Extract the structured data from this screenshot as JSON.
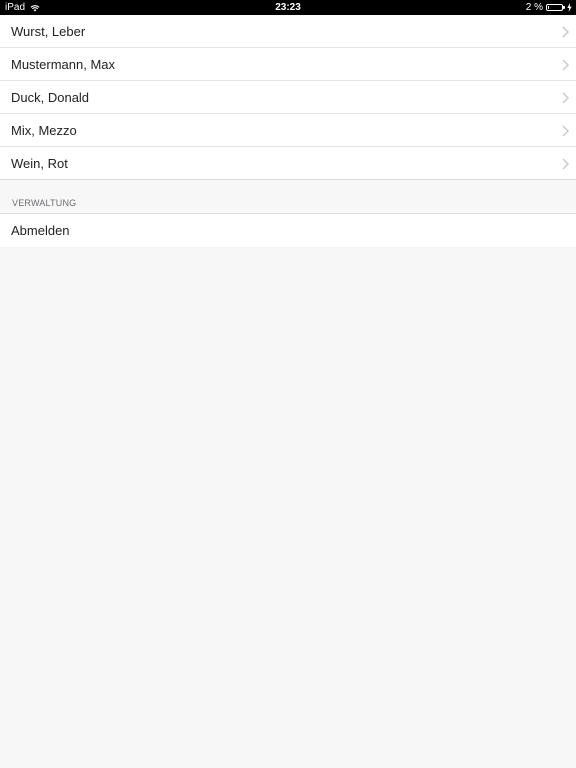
{
  "status_bar": {
    "device": "iPad",
    "time": "23:23",
    "battery_text": "2 %",
    "battery_level": 0.02
  },
  "contacts": [
    {
      "label": "Wurst, Leber"
    },
    {
      "label": "Mustermann, Max"
    },
    {
      "label": "Duck, Donald"
    },
    {
      "label": "Mix, Mezzo"
    },
    {
      "label": "Wein, Rot"
    }
  ],
  "admin_section": {
    "header": "VERWALTUNG",
    "items": [
      {
        "label": "Abmelden"
      }
    ]
  },
  "colors": {
    "background": "#f7f7f7",
    "cell": "#ffffff",
    "separator": "#e3e3e6",
    "chevron": "#c7c7cc",
    "section_header": "#6d6d72"
  }
}
